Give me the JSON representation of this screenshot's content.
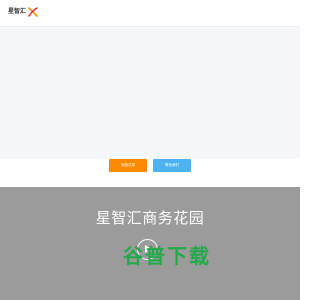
{
  "header": {
    "logo_text": "星智汇",
    "logo_mark_icon": "x-swoosh-logo-icon"
  },
  "buttons": {
    "primary_label": "免费试用",
    "secondary_label": "联系我们"
  },
  "band": {
    "title": "星智汇商务花园",
    "play_icon": "play-icon"
  },
  "watermark": {
    "text": "谷普下载"
  },
  "colors": {
    "primary_button": "#ff8a00",
    "secondary_button": "#4db3f0",
    "band_background": "#9b9b9b",
    "hero_background": "#f5f7fb",
    "watermark": "#22a94a"
  }
}
